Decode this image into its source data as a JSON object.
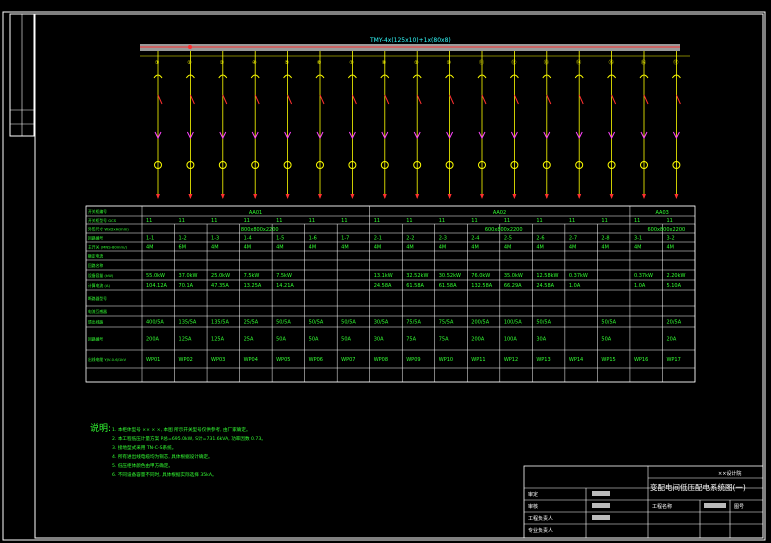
{
  "busbar": {
    "label": "TMY-4x(125x10)+1x(80x8)"
  },
  "circuits": [
    "①",
    "②",
    "③",
    "④",
    "⑤",
    "⑥",
    "⑦",
    "⑧",
    "⑨",
    "⑩",
    "⑪",
    "⑫",
    "⑬",
    "⑭",
    "⑮",
    "⑯",
    "⑰"
  ],
  "panels": [
    {
      "name": "AA01",
      "size": "800x800x2200"
    },
    {
      "name": "AA02",
      "size": "600x800x2200"
    },
    {
      "name": "AA03",
      "size": "600x800x2200"
    }
  ],
  "row_labels": [
    "开关柜编号",
    "开关柜型号 GCS",
    "外形尺寸 WxDxH(mm)",
    "回路编号",
    "主开关 (MNS-80mm/)",
    "额定电流",
    "回路名称",
    "设备容量 (kW)",
    "计算电流 (A)",
    "断路器型号",
    "电流互感器",
    "馈出线路",
    "回路编号",
    "出线电缆 YJV-0.6/1kV"
  ],
  "cells": {
    "type": [
      "11",
      "11",
      "11",
      "11",
      "11",
      "11",
      "11",
      "11",
      "11",
      "11",
      "11",
      "11",
      "11",
      "11",
      "11",
      "11",
      "11"
    ],
    "loop": [
      "1-1",
      "1-2",
      "1-3",
      "1-4",
      "1-5",
      "1-6",
      "1-7",
      "2-1",
      "2-2",
      "2-3",
      "2-4",
      "2-5",
      "2-6",
      "2-7",
      "2-8",
      "3-1",
      "3-2"
    ],
    "switch": [
      "4M",
      "6M",
      "4M",
      "4M",
      "4M",
      "4M",
      "4M",
      "4M",
      "4M",
      "4M",
      "4M",
      "4M",
      "4M",
      "4M",
      "4M",
      "4M",
      "4M"
    ],
    "capacity": [
      "55.0kW",
      "37.0kW",
      "25.0kW",
      "7.5kW",
      "7.5kW",
      "",
      "",
      "13.1kW",
      "32.52kW",
      "30.52kW",
      "76.0kW",
      "35.0kW",
      "12.58kW",
      "0.37kW",
      "",
      "0.37kW",
      "2.20kW"
    ],
    "current": [
      "104.12A",
      "70.1A",
      "47.35A",
      "13.25A",
      "14.21A",
      "",
      "",
      "24.58A",
      "61.58A",
      "61.58A",
      "132.58A",
      "66.29A",
      "24.58A",
      "1.0A",
      "",
      "1.0A",
      "5.10A"
    ],
    "breaker": [
      "400/5A",
      "135/5A",
      "135/5A",
      "25/5A",
      "50/5A",
      "50/5A",
      "50/5A",
      "30/5A",
      "75/5A",
      "75/5A",
      "200/5A",
      "100/5A",
      "50/5A",
      "",
      "50/5A",
      "",
      "20/5A"
    ],
    "ct": [
      "200A",
      "125A",
      "125A",
      "25A",
      "50A",
      "50A",
      "50A",
      "30A",
      "75A",
      "75A",
      "200A",
      "100A",
      "30A",
      "",
      "50A",
      "",
      "20A"
    ],
    "feeder": [
      "WP01",
      "WP02",
      "WP03",
      "WP04",
      "WP05",
      "WP06",
      "WP07",
      "WP08",
      "WP09",
      "WP10",
      "WP11",
      "WP12",
      "WP13",
      "WP14",
      "WP15",
      "WP16",
      "WP17"
    ]
  },
  "notes": {
    "title": "说明:",
    "lines": [
      "1. 本柜体型号 ×× × ×, 本图 所示开关型号仅供参考, 由厂家确定。",
      "2. 本工程低压计量方案 P总=695.0kW, S计=731.6kVA, 功率因数 0.73。",
      "3. 接地型式采用 TN-C-S系统。",
      "4. 所有进出线电缆均为铜芯, 具体根据设计确定。",
      "5. 低压柜体颜色由甲方确定。",
      "6. 不同设备容量不同时, 具体根据实际选择 35kA。"
    ]
  },
  "title_block": {
    "company": "××设计院",
    "drawing_title": "变配电间低压配电系统图(一)",
    "roles": [
      "审定",
      "审核",
      "工程负责人",
      "专业负责人"
    ],
    "project": "工程名称",
    "sheet": "图号"
  },
  "colors": {
    "green": "#33ff33",
    "yellow": "#ffff00",
    "red": "#ff3030",
    "magenta": "#ff44ff",
    "white": "#ffffff",
    "cyan": "#33ffff"
  }
}
